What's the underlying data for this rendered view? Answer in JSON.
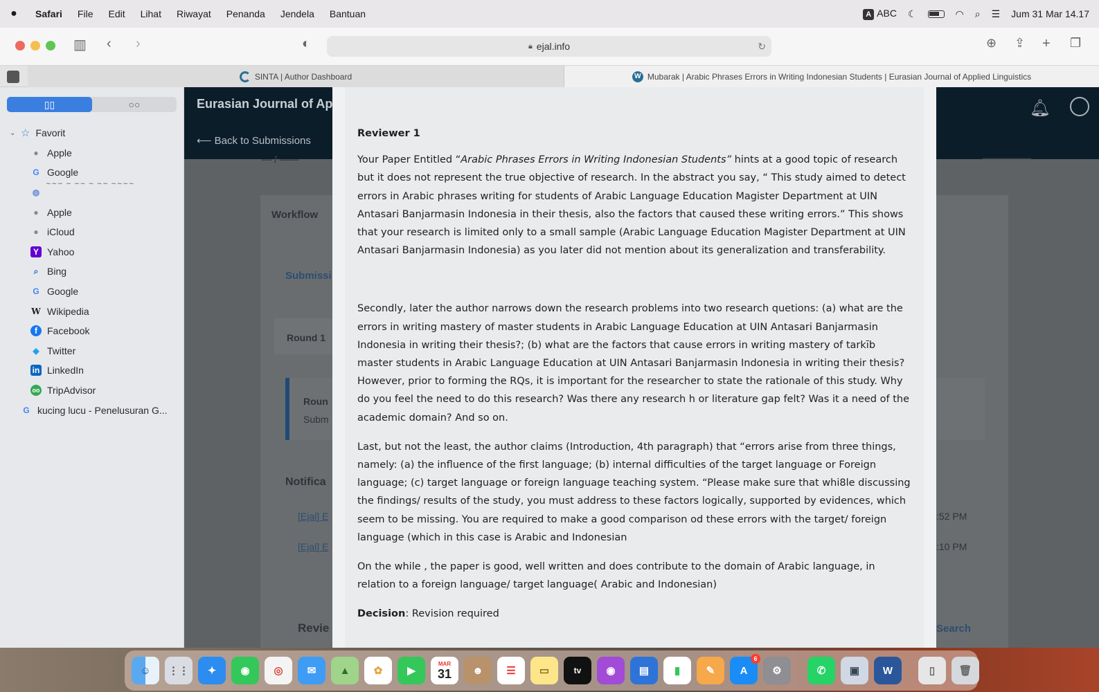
{
  "menubar": {
    "apple": "",
    "items": [
      "Safari",
      "File",
      "Edit",
      "Lihat",
      "Riwayat",
      "Penanda",
      "Jendela",
      "Bantuan"
    ],
    "input_method": "ABC",
    "input_badge": "A",
    "datetime": "Jum 31 Mar  14.17"
  },
  "toolbar": {
    "url": "ejal.info"
  },
  "tabs": [
    {
      "label": "SINTA | Author Dashboard"
    },
    {
      "label": "Mubarak | Arabic Phrases Errors in Writing Indonesian Students | Eurasian Journal of Applied Linguistics"
    }
  ],
  "sidebar": {
    "favorites_label": "Favorit",
    "items": [
      {
        "label": "Apple",
        "icon": "apple-icon"
      },
      {
        "label": "Google",
        "icon": "google-icon"
      },
      {
        "label": "",
        "icon": "globe-icon"
      },
      {
        "label": "Apple",
        "icon": "apple-icon"
      },
      {
        "label": "iCloud",
        "icon": "apple-icon"
      },
      {
        "label": "Yahoo",
        "icon": "yahoo-icon"
      },
      {
        "label": "Bing",
        "icon": "bing-icon"
      },
      {
        "label": "Google",
        "icon": "google-icon"
      },
      {
        "label": "Wikipedia",
        "icon": "wikipedia-icon"
      },
      {
        "label": "Facebook",
        "icon": "facebook-icon"
      },
      {
        "label": "Twitter",
        "icon": "twitter-icon"
      },
      {
        "label": "LinkedIn",
        "icon": "linkedin-icon"
      },
      {
        "label": "TripAdvisor",
        "icon": "tripadvisor-icon"
      }
    ],
    "history_item": "kucing lucu - Penelusuran G..."
  },
  "page": {
    "site_title": "Eurasian Journal of App",
    "back_link": "⟵ Back to Submissions",
    "workflow_tab": "Workflow",
    "submission_tab": "Submissi",
    "round_tab": "Round 1",
    "round_title": "Roun",
    "round_sub": "Subm",
    "notifications": "Notifica",
    "notif_link_1": "[Ejal] E",
    "notif_link_2": "[Ejal] E",
    "notif_time_1": ":52 PM",
    "notif_time_2": ":10 PM",
    "reviewers": "Revie",
    "search": "Search"
  },
  "modal": {
    "reviewer_title": "Reviewer 1",
    "p1_pre": "Your Paper Entitled “",
    "p1_italic": "Arabic Phrases Errors in Writing Indonesian Students”",
    "p1_post": " hints at a good topic of research but it does not represent the true objective of research. In the abstract you say, “ This study aimed to detect errors in Arabic phrases writing for students of Arabic Language Education Magister Department at UIN Antasari Banjarmasin Indonesia in their thesis, also the factors that caused these writing errors.” This shows that your research is limited only to a small sample (Arabic Language Education Magister Department at UIN Antasari Banjarmasin Indonesia) as you later did not mention about its generalization and transferability.",
    "p2": "Secondly, later the author narrows down the research problems into two research quetions: (a) what are the errors in writing mastery of master students in Arabic Language Education at UIN Antasari Banjarmasin Indonesia in writing their thesis?; (b) what are the factors that cause errors in writing mastery of tarkīb master students in Arabic Language Education at UIN Antasari Banjarmasin Indonesia in writing their thesis? However, prior to forming the RQs, it is important for the researcher to state the rationale of this study. Why do you feel the need to do this research? Was there any research h or literature gap felt? Was it a need of the academic domain? And so on.",
    "p3": "Last, but not the  least, the author claims (Introduction, 4th paragraph) that “errors arise from three things, namely: (a) the influence of the first language; (b) internal difficulties of the target language or Foreign language; (c) target language or foreign language teaching system. “Please make sure that whi8le discussing the findings/ results of the study, you must address to these factors logically, supported by evidences, which seem to be missing. You are required to make a good comparison od these errors with the target/ foreign language (which in this case is Arabic and Indonesian",
    "p4": "On the while , the paper is good, well written and does contribute to the domain of Arabic language, in relation to a foreign language/ target language( Arabic and Indonesian)",
    "decision_label": "Decision",
    "decision_value": ": Revision required"
  },
  "dock": {
    "calendar_month": "MAR",
    "calendar_day": "31",
    "tv_label": "tv",
    "appstore_badge": "6"
  }
}
